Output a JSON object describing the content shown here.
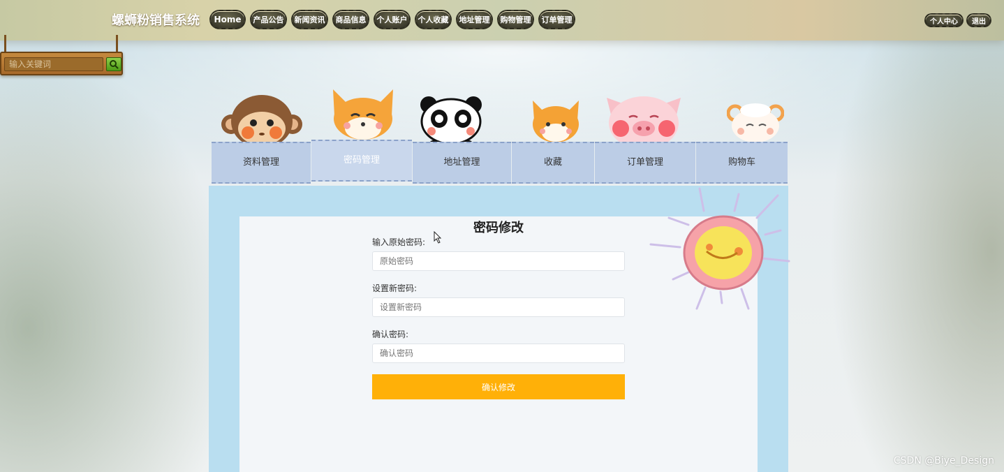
{
  "header": {
    "brand": "螺蛳粉销售系统",
    "nav": [
      {
        "label": "Home"
      },
      {
        "label": "产品公告"
      },
      {
        "label": "新闻资讯"
      },
      {
        "label": "商品信息"
      },
      {
        "label": "个人账户"
      },
      {
        "label": "个人收藏"
      },
      {
        "label": "地址管理"
      },
      {
        "label": "购物管理"
      },
      {
        "label": "订单管理"
      }
    ],
    "right": {
      "center": "个人中心",
      "logout": "退出"
    }
  },
  "search": {
    "placeholder": "输入关键词",
    "button_icon": "search-icon"
  },
  "tabs": [
    {
      "label": "资料管理",
      "animal": "monkey"
    },
    {
      "label": "密码管理",
      "animal": "fox",
      "active": true
    },
    {
      "label": "地址管理",
      "animal": "panda"
    },
    {
      "label": "收藏",
      "animal": "fox-small"
    },
    {
      "label": "订单管理",
      "animal": "pig"
    },
    {
      "label": "购物车",
      "animal": "sheep"
    }
  ],
  "form": {
    "title": "密码修改",
    "fields": [
      {
        "label": "输入原始密码:",
        "placeholder": "原始密码"
      },
      {
        "label": "设置新密码:",
        "placeholder": "设置新密码"
      },
      {
        "label": "确认密码:",
        "placeholder": "确认密码"
      }
    ],
    "submit": "确认修改"
  },
  "colors": {
    "accent": "#ffb008",
    "panel": "#b9def0",
    "tab": "#bccde6"
  },
  "watermark": "CSDN @Biye_Design"
}
